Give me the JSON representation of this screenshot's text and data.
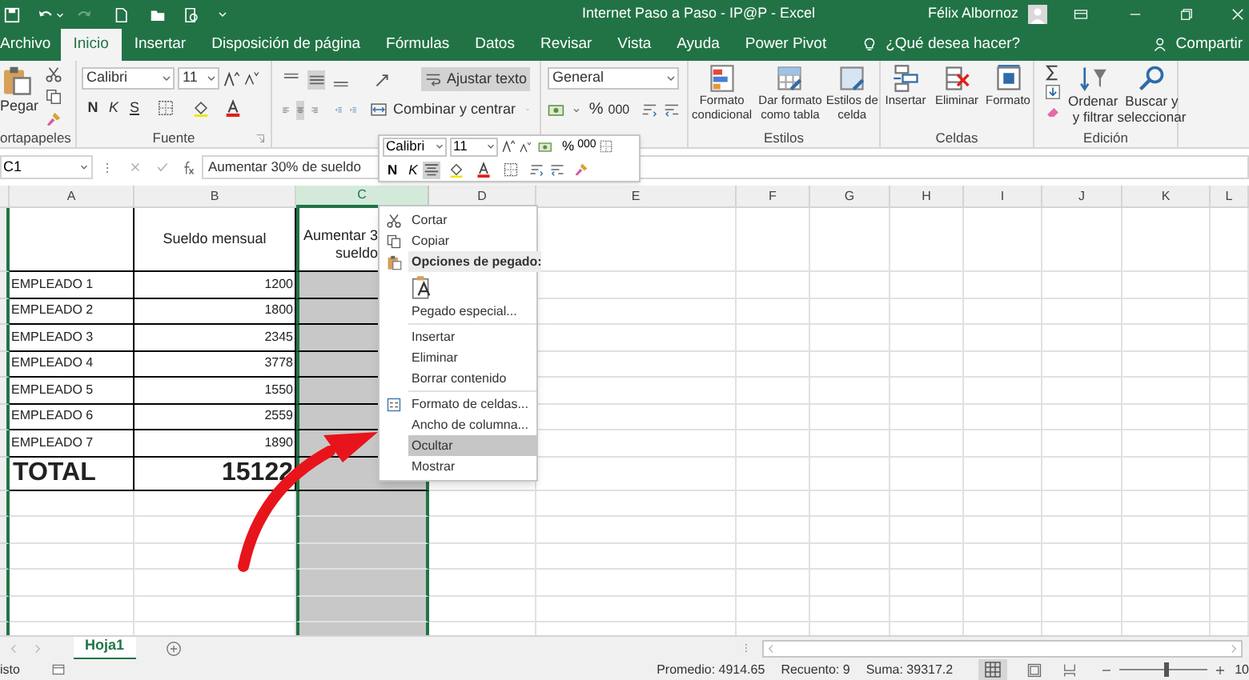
{
  "title_bar": {
    "title": "Internet Paso a Paso - IP@P - Excel",
    "user": "Félix Albornoz"
  },
  "tabs": [
    {
      "label": "Archivo",
      "selected": false
    },
    {
      "label": "Inicio",
      "selected": true
    },
    {
      "label": "Insertar",
      "selected": false
    },
    {
      "label": "Disposición de página",
      "selected": false
    },
    {
      "label": "Fórmulas",
      "selected": false
    },
    {
      "label": "Datos",
      "selected": false
    },
    {
      "label": "Revisar",
      "selected": false
    },
    {
      "label": "Vista",
      "selected": false
    },
    {
      "label": "Ayuda",
      "selected": false
    },
    {
      "label": "Power Pivot",
      "selected": false
    }
  ],
  "tell_me": "¿Qué desea hacer?",
  "share": "Compartir",
  "ribbon": {
    "clipboard": {
      "paste": "Pegar",
      "group_label": "ortapapeles"
    },
    "font": {
      "name": "Calibri",
      "size": "11",
      "bold": "N",
      "italic": "K",
      "underline": "S",
      "group_label": "Fuente"
    },
    "alignment": {
      "wrap_text": {
        "label": "Ajustar texto",
        "on": true
      },
      "merge": {
        "label": "Combinar y centrar",
        "on": false
      }
    },
    "number": {
      "format": "General",
      "percent": "%",
      "thousands": "000"
    },
    "styles": {
      "buttons": [
        "Formato condicional",
        "Dar formato como tabla",
        "Estilos de celda"
      ],
      "group_label": "Estilos"
    },
    "cells": {
      "buttons": [
        "Insertar",
        "Eliminar",
        "Formato"
      ],
      "group_label": "Celdas"
    },
    "editing": {
      "buttons": [
        "Ordenar y filtrar",
        "Buscar y seleccionar"
      ],
      "group_label": "Edición"
    }
  },
  "formula_bar": {
    "name_box": "C1",
    "formula": "Aumentar 30% de sueldo"
  },
  "mini_toolbar": {
    "font": "Calibri",
    "size": "11",
    "percent": "%",
    "thousands": "000",
    "bold": "N",
    "italic": "K",
    "center_on": true
  },
  "sheet": {
    "columns": [
      {
        "label": "A",
        "selected": false
      },
      {
        "label": "B",
        "selected": false
      },
      {
        "label": "C",
        "selected": true
      },
      {
        "label": "D",
        "selected": false
      },
      {
        "label": "E",
        "selected": false
      },
      {
        "label": "F",
        "selected": false
      },
      {
        "label": "G",
        "selected": false
      },
      {
        "label": "H",
        "selected": false
      },
      {
        "label": "I",
        "selected": false
      },
      {
        "label": "J",
        "selected": false
      },
      {
        "label": "K",
        "selected": false
      },
      {
        "label": "L",
        "selected": false
      }
    ],
    "header_row": {
      "b": "Sueldo mensual",
      "c_line_1": "Aumentar 3",
      "c_line_2": "sueldo"
    },
    "rows": [
      {
        "name": "EMPLEADO 1",
        "salary": "1200"
      },
      {
        "name": "EMPLEADO 2",
        "salary": "1800"
      },
      {
        "name": "EMPLEADO 3",
        "salary": "2345"
      },
      {
        "name": "EMPLEADO 4",
        "salary": "3778"
      },
      {
        "name": "EMPLEADO 5",
        "salary": "1550"
      },
      {
        "name": "EMPLEADO 6",
        "salary": "2559"
      },
      {
        "name": "EMPLEADO 7",
        "salary": "1890"
      }
    ],
    "total": {
      "label": "TOTAL",
      "salary": "15122"
    }
  },
  "context_menu": [
    {
      "kind": "item",
      "label": "Cortar",
      "selected": false
    },
    {
      "kind": "item",
      "label": "Copiar",
      "selected": false
    },
    {
      "kind": "header",
      "label": "Opciones de pegado:",
      "selected": false
    },
    {
      "kind": "paste-options",
      "selected": false
    },
    {
      "kind": "item",
      "label": "Pegado especial...",
      "selected": false
    },
    {
      "kind": "item",
      "label": "Insertar",
      "selected": false
    },
    {
      "kind": "item",
      "label": "Eliminar",
      "selected": false
    },
    {
      "kind": "item",
      "label": "Borrar contenido",
      "selected": false
    },
    {
      "kind": "item",
      "label": "Formato de celdas...",
      "selected": false
    },
    {
      "kind": "item",
      "label": "Ancho de columna...",
      "selected": false
    },
    {
      "kind": "item",
      "label": "Ocultar",
      "selected": true
    },
    {
      "kind": "item",
      "label": "Mostrar",
      "selected": false
    }
  ],
  "sheet_tabs": [
    {
      "label": "Hoja1",
      "selected": true
    }
  ],
  "status_bar": {
    "ready": "isto",
    "stats": [
      "Promedio: 4914.65",
      "Recuento: 9",
      "Suma: 39317.2"
    ],
    "zoom_slider": {
      "level": 0.5
    },
    "zoom": "10"
  }
}
